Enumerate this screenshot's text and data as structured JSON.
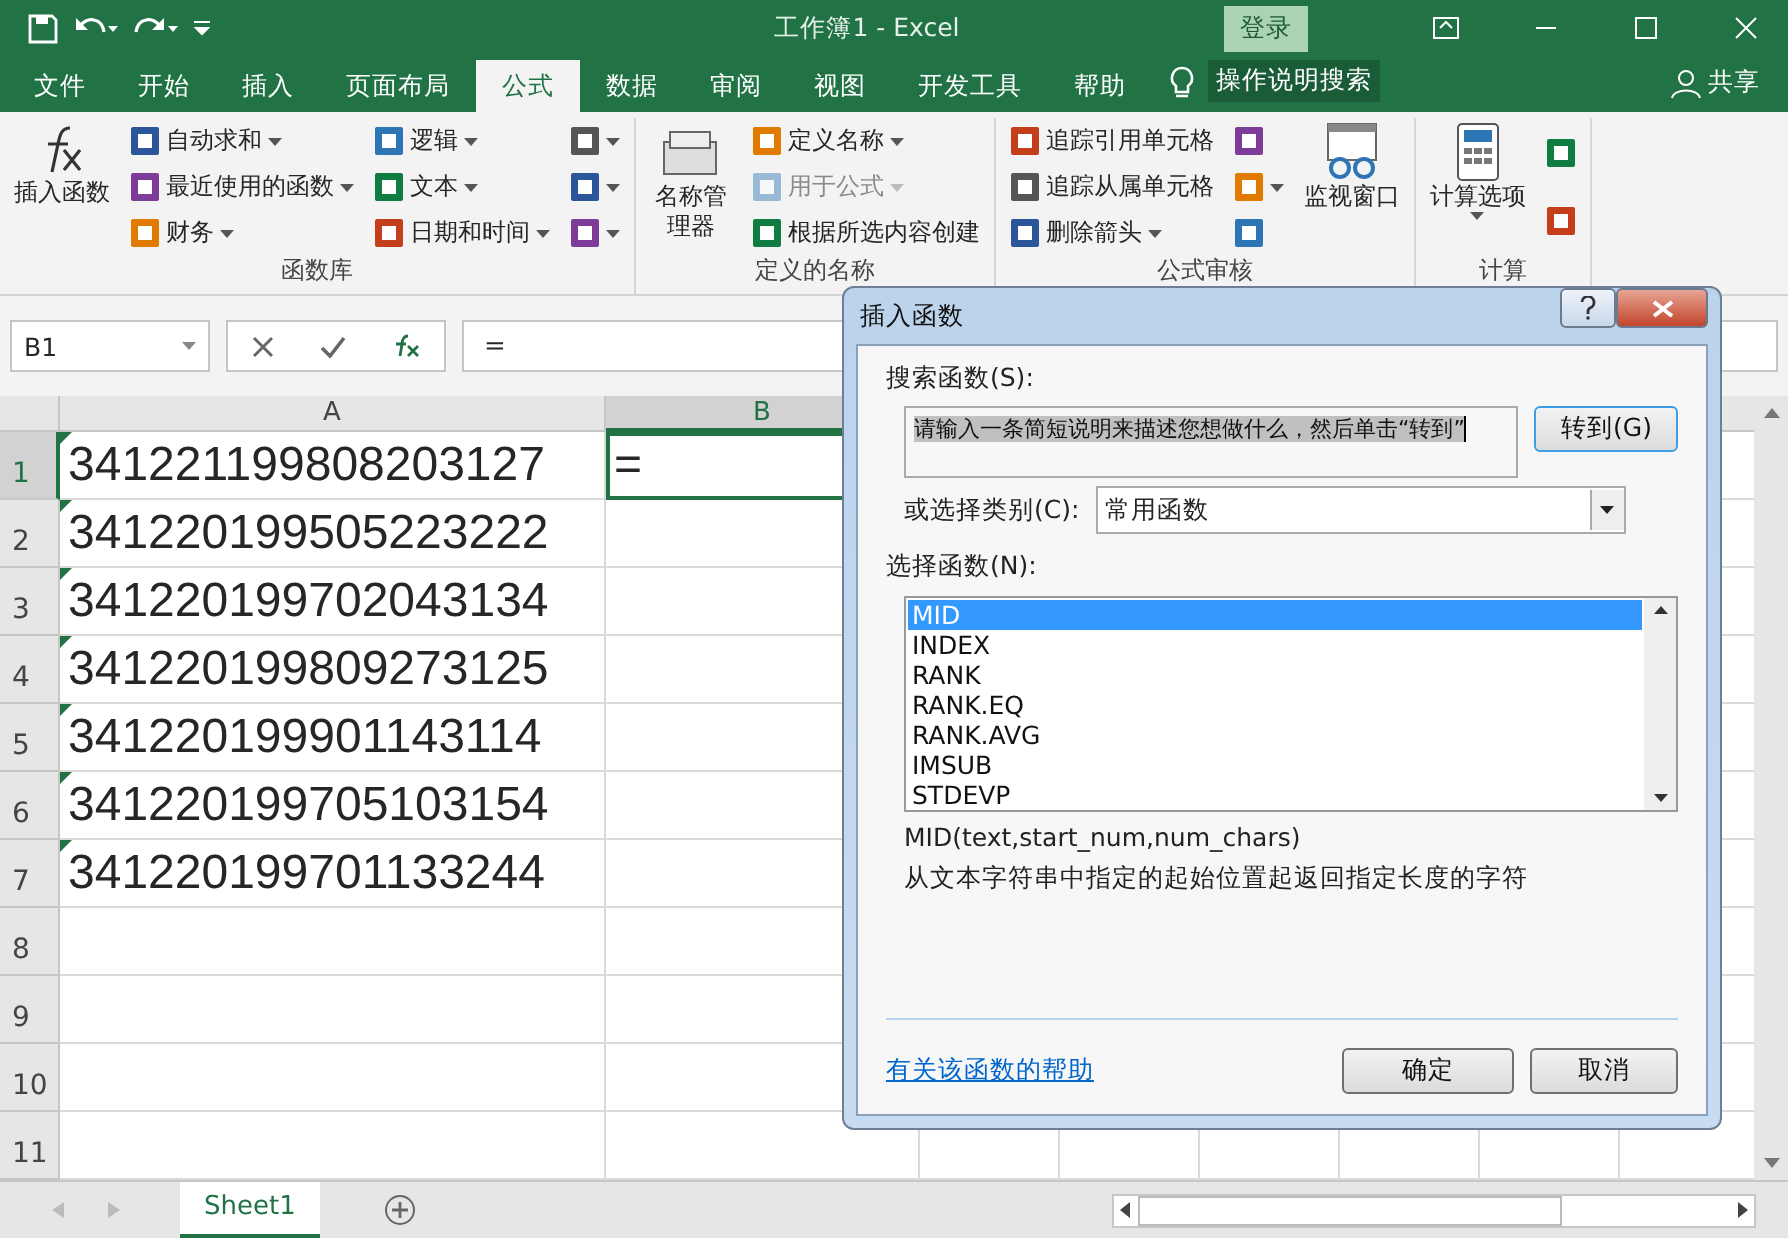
{
  "title_bar": {
    "title": "工作簿1  -  Excel",
    "login": "登录"
  },
  "ribbon_tabs": [
    {
      "label": "文件",
      "selected": false
    },
    {
      "label": "开始",
      "selected": false
    },
    {
      "label": "插入",
      "selected": false
    },
    {
      "label": "页面布局",
      "selected": false
    },
    {
      "label": "公式",
      "selected": true
    },
    {
      "label": "数据",
      "selected": false
    },
    {
      "label": "审阅",
      "selected": false
    },
    {
      "label": "视图",
      "selected": false
    },
    {
      "label": "开发工具",
      "selected": false
    },
    {
      "label": "帮助",
      "selected": false
    }
  ],
  "tell_me": "操作说明搜索",
  "share": "共享",
  "ribbon_groups": [
    {
      "label": "函数库",
      "columns": [
        [
          {
            "kind": "big",
            "label": "插入函数",
            "dropdown": false,
            "disabled": false
          }
        ],
        [
          {
            "kind": "small",
            "label": "自动求和",
            "dropdown": true,
            "disabled": false
          },
          {
            "kind": "small",
            "label": "最近使用的函数",
            "dropdown": true,
            "disabled": false
          },
          {
            "kind": "small",
            "label": "财务",
            "dropdown": true,
            "disabled": false
          }
        ],
        [
          {
            "kind": "small",
            "label": "逻辑",
            "dropdown": true,
            "disabled": false
          },
          {
            "kind": "small",
            "label": "文本",
            "dropdown": true,
            "disabled": false
          },
          {
            "kind": "small",
            "label": "日期和时间",
            "dropdown": true,
            "disabled": false
          }
        ],
        [
          {
            "kind": "icon",
            "dropdown": true,
            "disabled": false
          },
          {
            "kind": "icon",
            "dropdown": true,
            "disabled": false
          },
          {
            "kind": "icon",
            "dropdown": true,
            "disabled": false
          }
        ]
      ]
    },
    {
      "label": "定义的名称",
      "columns": [
        [
          {
            "kind": "big",
            "label": "名称管理器",
            "dropdown": false,
            "disabled": false
          }
        ],
        [
          {
            "kind": "small",
            "label": "定义名称",
            "dropdown": true,
            "disabled": false
          },
          {
            "kind": "small",
            "label": "用于公式",
            "dropdown": true,
            "disabled": true
          },
          {
            "kind": "small",
            "label": "根据所选内容创建",
            "dropdown": false,
            "disabled": false
          }
        ]
      ]
    },
    {
      "label": "公式审核",
      "columns": [
        [
          {
            "kind": "small",
            "label": "追踪引用单元格",
            "dropdown": false,
            "disabled": false
          },
          {
            "kind": "small",
            "label": "追踪从属单元格",
            "dropdown": false,
            "disabled": false
          },
          {
            "kind": "small",
            "label": "删除箭头",
            "dropdown": true,
            "disabled": false
          }
        ],
        [
          {
            "kind": "icon",
            "dropdown": false,
            "disabled": false
          },
          {
            "kind": "icon",
            "dropdown": true,
            "disabled": false
          },
          {
            "kind": "icon",
            "dropdown": false,
            "disabled": false
          }
        ],
        [
          {
            "kind": "big",
            "label": "监视窗口",
            "dropdown": false,
            "disabled": false
          }
        ]
      ]
    },
    {
      "label": "计算",
      "columns": [
        [
          {
            "kind": "big",
            "label": "计算选项",
            "dropdown": true,
            "disabled": false
          }
        ],
        [
          {
            "kind": "icon",
            "dropdown": false,
            "disabled": false
          },
          {
            "kind": "icon",
            "dropdown": false,
            "disabled": false
          }
        ]
      ]
    }
  ],
  "formula_bar": {
    "name_box": "B1",
    "formula": "="
  },
  "sheet": {
    "columns": [
      {
        "label": "A",
        "selected": false
      },
      {
        "label": "B",
        "selected": true
      }
    ],
    "rows": [
      {
        "number": "1",
        "selected": true,
        "cells": [
          {
            "value": "341221199808203127",
            "selected": false
          },
          {
            "value": "=",
            "selected": true
          }
        ]
      },
      {
        "number": "2",
        "selected": false,
        "cells": [
          {
            "value": "341220199505223222",
            "selected": false
          }
        ]
      },
      {
        "number": "3",
        "selected": false,
        "cells": [
          {
            "value": "341220199702043134",
            "selected": false
          }
        ]
      },
      {
        "number": "4",
        "selected": false,
        "cells": [
          {
            "value": "341220199809273125",
            "selected": false
          }
        ]
      },
      {
        "number": "5",
        "selected": false,
        "cells": [
          {
            "value": "341220199901143114",
            "selected": false
          }
        ]
      },
      {
        "number": "6",
        "selected": false,
        "cells": [
          {
            "value": "341220199705103154",
            "selected": false
          }
        ]
      },
      {
        "number": "7",
        "selected": false,
        "cells": [
          {
            "value": "341220199701133244",
            "selected": false
          }
        ]
      },
      {
        "number": "8",
        "selected": false,
        "cells": []
      },
      {
        "number": "9",
        "selected": false,
        "cells": []
      },
      {
        "number": "10",
        "selected": false,
        "cells": []
      },
      {
        "number": "11",
        "selected": false,
        "cells": []
      }
    ]
  },
  "sheet_tabs": [
    {
      "label": "Sheet1",
      "selected": true
    }
  ],
  "dialog": {
    "title": "插入函数",
    "search_label": "搜索函数(S):",
    "search_value": "请输入一条简短说明来描述您想做什么，然后单击“转到”",
    "go_button": "转到(G)",
    "category_label": "或选择类别(C):",
    "category": "常用函数",
    "functions_label": "选择函数(N):",
    "functions": [
      {
        "name": "MID",
        "selected": true
      },
      {
        "name": "INDEX",
        "selected": false
      },
      {
        "name": "RANK",
        "selected": false
      },
      {
        "name": "RANK.EQ",
        "selected": false
      },
      {
        "name": "RANK.AVG",
        "selected": false
      },
      {
        "name": "IMSUB",
        "selected": false
      },
      {
        "name": "STDEVP",
        "selected": false
      }
    ],
    "signature": "MID(text,start_num,num_chars)",
    "description": "从文本字符串中指定的起始位置起返回指定长度的字符",
    "help_link": "有关该函数的帮助",
    "ok": "确定",
    "cancel": "取消"
  }
}
